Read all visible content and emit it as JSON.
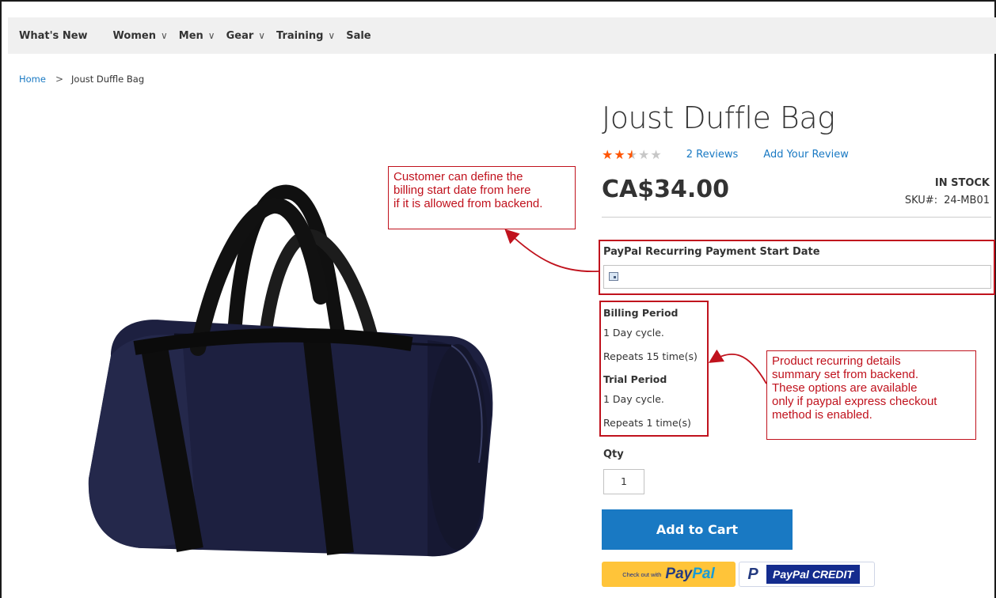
{
  "nav": {
    "items": [
      {
        "label": "What's New",
        "has_dropdown": false
      },
      {
        "label": "Women",
        "has_dropdown": true
      },
      {
        "label": "Men",
        "has_dropdown": true
      },
      {
        "label": "Gear",
        "has_dropdown": true
      },
      {
        "label": "Training",
        "has_dropdown": true
      },
      {
        "label": "Sale",
        "has_dropdown": false
      }
    ],
    "dropdown_glyph": "∨"
  },
  "breadcrumb": {
    "home": "Home",
    "separator": ">",
    "current": "Joust Duffle Bag"
  },
  "product": {
    "title": "Joust Duffle Bag",
    "rating": {
      "stars_filled": 2.5,
      "stars_total": 5
    },
    "reviews_link": "2  Reviews",
    "add_review_link": "Add Your Review",
    "price": "CA$34.00",
    "stock": "IN STOCK",
    "sku_label": "SKU#:",
    "sku_value": "24-MB01",
    "image_icon": "duffle-bag-image"
  },
  "recurring": {
    "start_date_label": "PayPal Recurring Payment Start Date",
    "start_date_value": "",
    "billing_period_title": "Billing Period",
    "billing_cycle": "1 Day cycle.",
    "billing_repeats": "Repeats 15 time(s)",
    "trial_period_title": "Trial Period",
    "trial_cycle": "1 Day cycle.",
    "trial_repeats": "Repeats 1 time(s)"
  },
  "cart": {
    "qty_label": "Qty",
    "qty_value": "1",
    "add_to_cart_label": "Add to Cart",
    "paypal_checkout_text": "Check out with",
    "paypal_logo_pay": "Pay",
    "paypal_logo_pal": "Pal",
    "paypal_credit_badge": "P",
    "paypal_credit_text": "PayPal CREDIT"
  },
  "annotations": {
    "callout_1": [
      "Customer can define the",
      "billing start date from here",
      "if it is allowed from backend."
    ],
    "callout_2": [
      "Product recurring details",
      "summary set from backend.",
      "These options are available",
      "only if paypal express checkout",
      "method is enabled."
    ],
    "annotation_color": "#c0121d"
  },
  "colors": {
    "link": "#1979c3",
    "button_primary": "#1979c3",
    "star_filled": "#ff5501",
    "star_empty": "#c7c7c7",
    "paypal_yellow": "#ffc439",
    "paypal_navy": "#253b80",
    "paypal_blue": "#179bd7"
  }
}
